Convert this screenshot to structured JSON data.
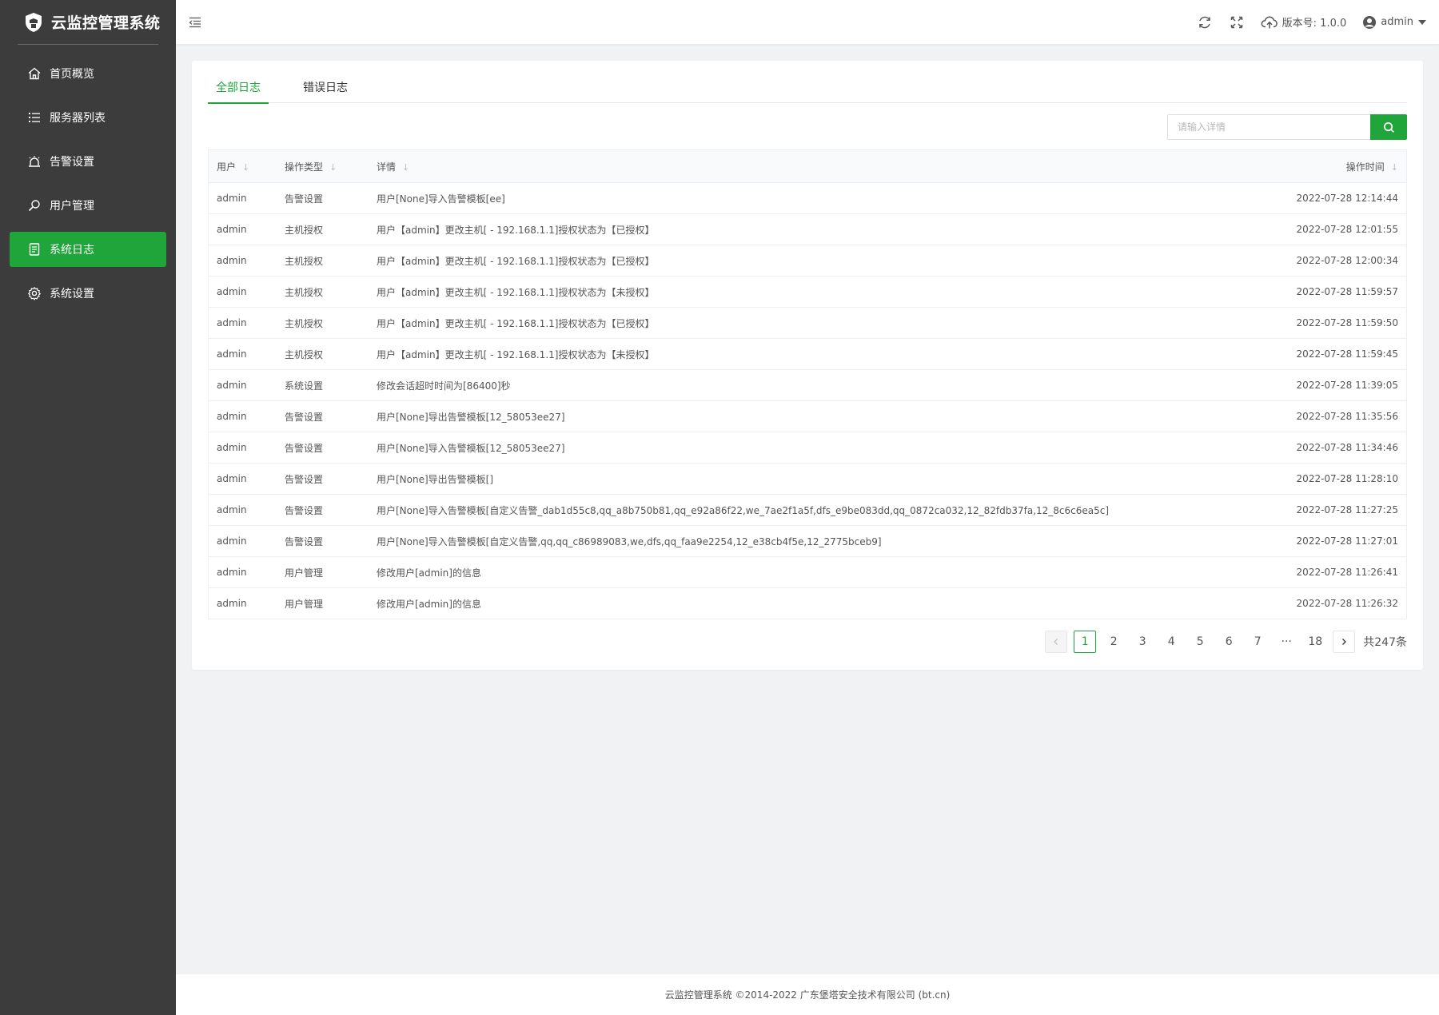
{
  "app": {
    "title": "云监控管理系统"
  },
  "sidebar": {
    "items": [
      {
        "label": "首页概览",
        "icon": "home-icon"
      },
      {
        "label": "服务器列表",
        "icon": "list-icon"
      },
      {
        "label": "告警设置",
        "icon": "alarm-icon"
      },
      {
        "label": "用户管理",
        "icon": "user-search-icon"
      },
      {
        "label": "系统日志",
        "icon": "log-icon",
        "active": true
      },
      {
        "label": "系统设置",
        "icon": "gear-icon"
      }
    ]
  },
  "topbar": {
    "version": "版本号: 1.0.0",
    "user": "admin"
  },
  "tabs": [
    {
      "label": "全部日志",
      "active": true
    },
    {
      "label": "错误日志"
    }
  ],
  "search": {
    "placeholder": "请输入详情",
    "value": ""
  },
  "table": {
    "headers": {
      "user": "用户",
      "type": "操作类型",
      "detail": "详情",
      "time": "操作时间"
    },
    "rows": [
      {
        "user": "admin",
        "type": "告警设置",
        "detail": "用户[None]导入告警模板[ee]",
        "time": "2022-07-28 12:14:44"
      },
      {
        "user": "admin",
        "type": "主机授权",
        "detail": "用户【admin】更改主机[ - 192.168.1.1]授权状态为【已授权】",
        "time": "2022-07-28 12:01:55"
      },
      {
        "user": "admin",
        "type": "主机授权",
        "detail": "用户【admin】更改主机[ - 192.168.1.1]授权状态为【已授权】",
        "time": "2022-07-28 12:00:34"
      },
      {
        "user": "admin",
        "type": "主机授权",
        "detail": "用户【admin】更改主机[ - 192.168.1.1]授权状态为【未授权】",
        "time": "2022-07-28 11:59:57"
      },
      {
        "user": "admin",
        "type": "主机授权",
        "detail": "用户【admin】更改主机[ - 192.168.1.1]授权状态为【已授权】",
        "time": "2022-07-28 11:59:50"
      },
      {
        "user": "admin",
        "type": "主机授权",
        "detail": "用户【admin】更改主机[ - 192.168.1.1]授权状态为【未授权】",
        "time": "2022-07-28 11:59:45"
      },
      {
        "user": "admin",
        "type": "系统设置",
        "detail": "修改会话超时时间为[86400]秒",
        "time": "2022-07-28 11:39:05"
      },
      {
        "user": "admin",
        "type": "告警设置",
        "detail": "用户[None]导出告警模板[12_58053ee27]",
        "time": "2022-07-28 11:35:56"
      },
      {
        "user": "admin",
        "type": "告警设置",
        "detail": "用户[None]导入告警模板[12_58053ee27]",
        "time": "2022-07-28 11:34:46"
      },
      {
        "user": "admin",
        "type": "告警设置",
        "detail": "用户[None]导出告警模板[]",
        "time": "2022-07-28 11:28:10"
      },
      {
        "user": "admin",
        "type": "告警设置",
        "detail": "用户[None]导入告警模板[自定义告警_dab1d55c8,qq_a8b750b81,qq_e92a86f22,we_7ae2f1a5f,dfs_e9be083dd,qq_0872ca032,12_82fdb37fa,12_8c6c6ea5c]",
        "time": "2022-07-28 11:27:25"
      },
      {
        "user": "admin",
        "type": "告警设置",
        "detail": "用户[None]导入告警模板[自定义告警,qq,qq_c86989083,we,dfs,qq_faa9e2254,12_e38cb4f5e,12_2775bceb9]",
        "time": "2022-07-28 11:27:01"
      },
      {
        "user": "admin",
        "type": "用户管理",
        "detail": "修改用户[admin]的信息",
        "time": "2022-07-28 11:26:41"
      },
      {
        "user": "admin",
        "type": "用户管理",
        "detail": "修改用户[admin]的信息",
        "time": "2022-07-28 11:26:32"
      }
    ]
  },
  "pagination": {
    "pages": [
      "1",
      "2",
      "3",
      "4",
      "5",
      "6",
      "7",
      "···",
      "18"
    ],
    "current": "1",
    "total": "共247条"
  },
  "footer": {
    "text": "云监控管理系统 ©2014-2022 广东堡塔安全技术有限公司 (bt.cn)"
  },
  "colors": {
    "accent": "#20a53a",
    "sidebar_bg": "#3c3c3c"
  }
}
